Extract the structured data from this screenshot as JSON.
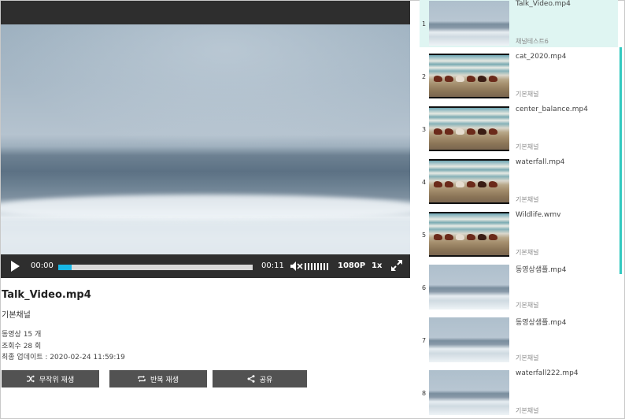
{
  "player": {
    "current_time": "00:00",
    "duration": "00:11",
    "progress": 0.07,
    "quality": "1080P",
    "speed": "1x"
  },
  "info": {
    "title": "Talk_Video.mp4",
    "channel": "기본채널",
    "video_count": "동영상 15 개",
    "view_count": "조회수 28 회",
    "last_update": "최종 업데이트 : 2020-02-24 11:59:19"
  },
  "actions": {
    "shuffle": "무작위 재생",
    "repeat": "반복 재생",
    "share": "공유"
  },
  "playlist": [
    {
      "num": "1",
      "title": "Talk_Video.mp4",
      "channel": "채널테스트6",
      "thumb": "sea",
      "active": true
    },
    {
      "num": "2",
      "title": "cat_2020.mp4",
      "channel": "기본채널",
      "thumb": "horse"
    },
    {
      "num": "3",
      "title": "center_balance.mp4",
      "channel": "기본채널",
      "thumb": "horse"
    },
    {
      "num": "4",
      "title": "waterfall.mp4",
      "channel": "기본채널",
      "thumb": "horse"
    },
    {
      "num": "5",
      "title": "Wildlife.wmv",
      "channel": "기본채널",
      "thumb": "horse"
    },
    {
      "num": "6",
      "title": "동영상샘플.mp4",
      "channel": "기본채널",
      "thumb": "sea"
    },
    {
      "num": "7",
      "title": "동영상샘플.mp4",
      "channel": "기본채널",
      "thumb": "sea"
    },
    {
      "num": "8",
      "title": "waterfall222.mp4",
      "channel": "기본채널",
      "thumb": "sea"
    }
  ],
  "colors": {
    "accent": "#17b7e6",
    "active_row": "#dff5f2",
    "scrollbar": "#32c9c0",
    "button_bg": "#525252"
  }
}
